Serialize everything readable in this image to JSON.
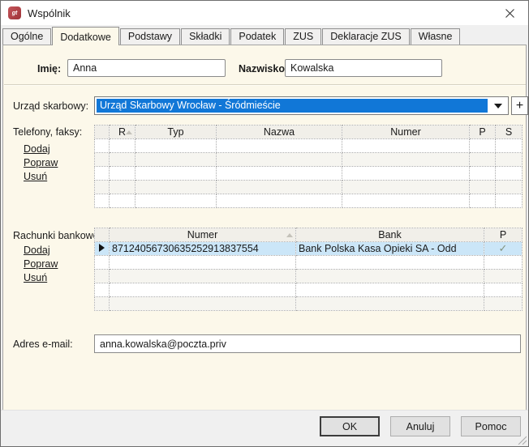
{
  "window": {
    "title": "Wspólnik"
  },
  "tabs": [
    {
      "label": "Ogólne"
    },
    {
      "label": "Dodatkowe"
    },
    {
      "label": "Podstawy"
    },
    {
      "label": "Składki"
    },
    {
      "label": "Podatek"
    },
    {
      "label": "ZUS"
    },
    {
      "label": "Deklaracje ZUS"
    },
    {
      "label": "Własne"
    }
  ],
  "active_tab": "Dodatkowe",
  "form": {
    "first_name": {
      "label": "Imię:",
      "value": "Anna"
    },
    "last_name": {
      "label": "Nazwisko:",
      "value": "Kowalska"
    },
    "tax_office": {
      "label": "Urząd skarbowy:",
      "selected": "Urząd Skarbowy Wrocław - Śródmieście",
      "add_button_label": "+"
    },
    "email": {
      "label": "Adres e-mail:",
      "value": "anna.kowalska@poczta.priv"
    }
  },
  "phones": {
    "section_label": "Telefony, faksy:",
    "actions": [
      {
        "label": "Dodaj"
      },
      {
        "label": "Popraw"
      },
      {
        "label": "Usuń"
      }
    ],
    "columns": {
      "r": "R",
      "typ": "Typ",
      "nazwa": "Nazwa",
      "numer": "Numer",
      "p": "P",
      "s": "S"
    },
    "rows": []
  },
  "bank_accounts": {
    "section_label": "Rachunki bankowe:",
    "actions": [
      {
        "label": "Dodaj"
      },
      {
        "label": "Popraw"
      },
      {
        "label": "Usuń"
      }
    ],
    "columns": {
      "numer": "Numer",
      "bank": "Bank",
      "p": "P"
    },
    "rows": [
      {
        "numer": "87124056730635252913837554",
        "bank": "Bank Polska Kasa Opieki SA  - Odd",
        "p": "✓",
        "selected": true
      }
    ]
  },
  "footer": {
    "ok": "OK",
    "cancel": "Anuluj",
    "help": "Pomoc"
  },
  "colors": {
    "selection_blue": "#1177d7",
    "selected_row_blue": "#cbe6f8",
    "panel_cream": "#fcf8ea",
    "chrome_gray": "#f0f0f0",
    "check_green_gray": "#83937f",
    "send_arrow_green": "#1e9e3e",
    "app_icon_red": "#a83b40"
  }
}
